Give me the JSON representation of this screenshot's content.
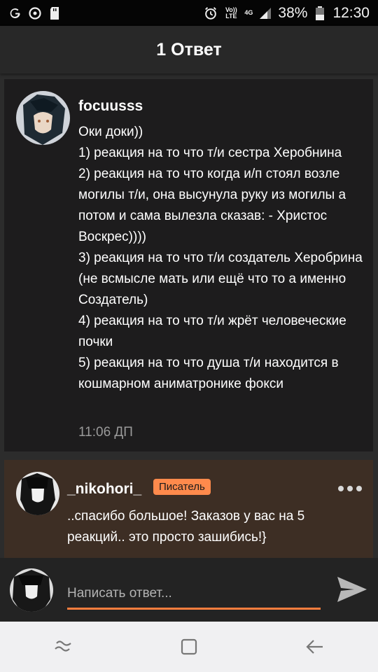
{
  "statusbar": {
    "battery_percent": "38%",
    "time": "12:30",
    "volte_label": "Vo)) LTE",
    "network_label": "4G"
  },
  "header": {
    "title": "1 Ответ"
  },
  "post": {
    "username": "focuusss",
    "text": "Оки доки))\n1) реакция на то что т/и сестра Херобнина\n2) реакция на то что когда и/п стоял возле могилы т/и, она высунула руку из могилы а потом и сама вылезла сказав: - Христос Воскрес))))\n3) реакция на то что т/и создатель Херобрина (не всмысле мать или ещё что то а именно Создатель)\n4) реакция на то что т/и жрёт человеческие почки\n5) реакция на то что душа т/и находится в кошмарном аниматронике фокси",
    "time": "11:06 ДП"
  },
  "reply": {
    "username": "_nikohori_",
    "badge": "Писатель",
    "text": "..спасибо большое! Заказов у вас на 5 реакций.. это просто зашибись!}"
  },
  "compose": {
    "placeholder": "Написать ответ..."
  },
  "colors": {
    "accent": "#ff7e3e",
    "badge": "#ff8a4c",
    "reply_bg": "#3d2e24",
    "card_bg": "#1d1c1d"
  },
  "icons": {
    "status_left": [
      "g-icon",
      "sync-icon",
      "sd-card-icon"
    ],
    "status_right": [
      "alarm-icon",
      "signal-icon",
      "battery-icon"
    ],
    "nav": [
      "recents-icon",
      "home-icon",
      "back-icon"
    ]
  }
}
